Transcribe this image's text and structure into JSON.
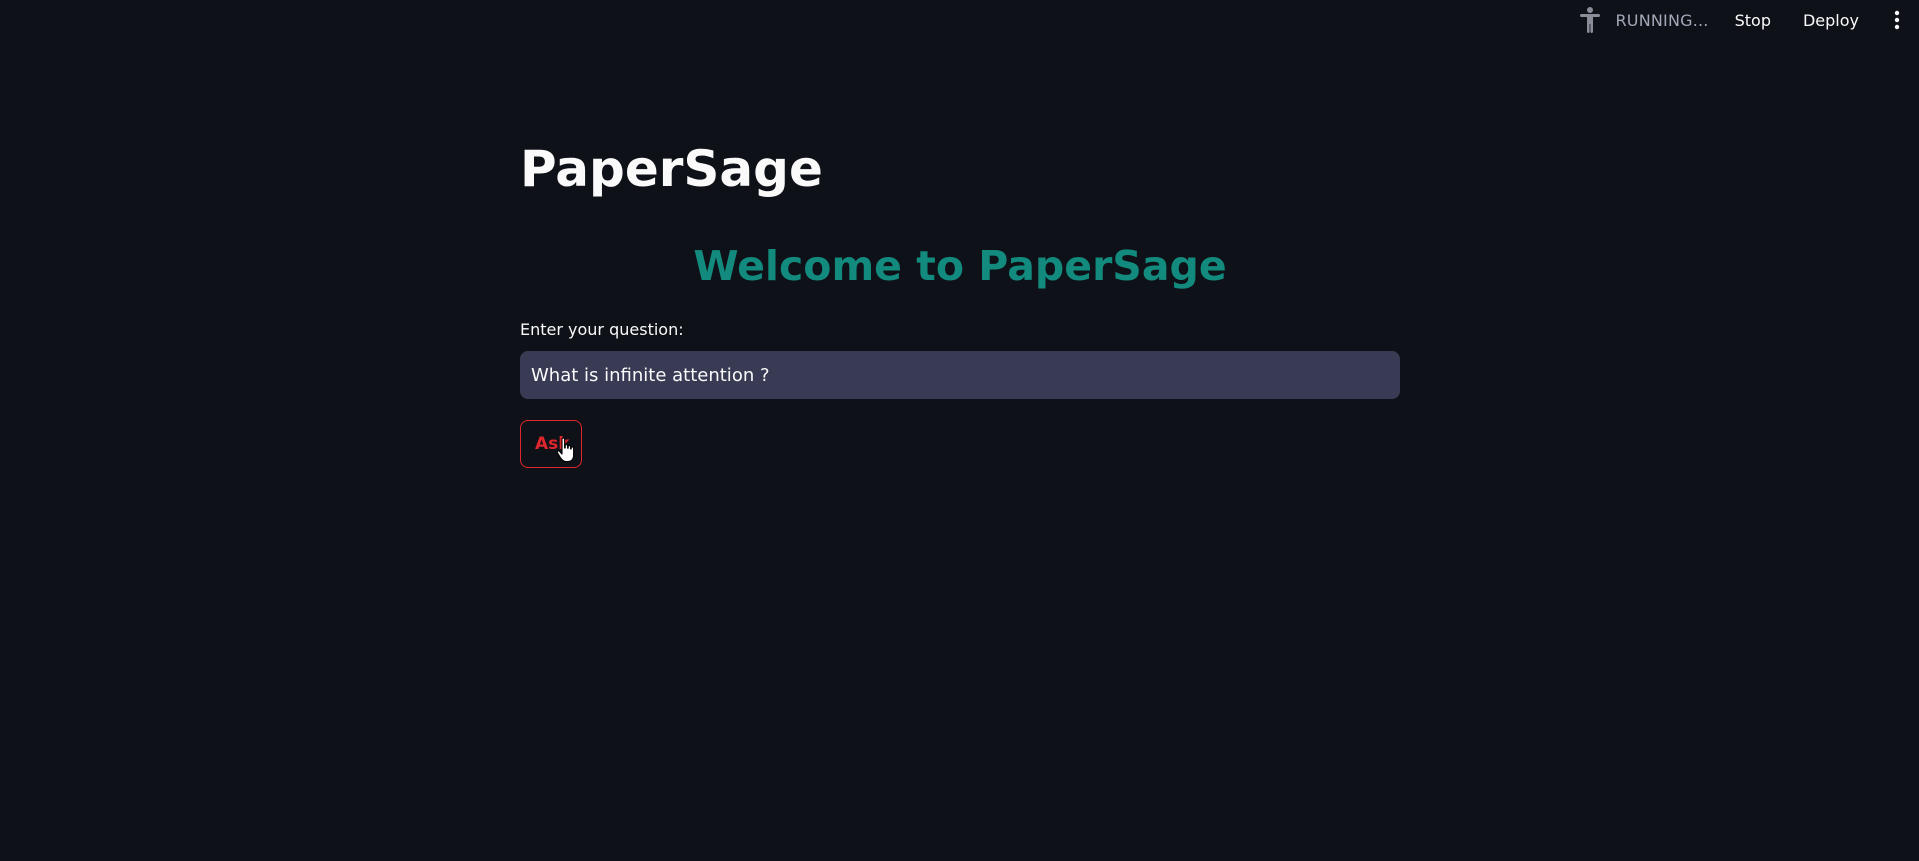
{
  "toolbar": {
    "status_icon": "accessibility-person-icon",
    "status_text": "RUNNING...",
    "stop_label": "Stop",
    "deploy_label": "Deploy",
    "menu_icon": "more-vertical-icon"
  },
  "main": {
    "app_title": "PaperSage",
    "welcome_heading": "Welcome to PaperSage",
    "question_label": "Enter your question:",
    "question_value": "What is infinite attention ?",
    "ask_label": "Ask"
  },
  "colors": {
    "background": "#0e1117",
    "heading_accent": "#138a7e",
    "input_background": "#393a54",
    "button_accent": "#e0262d",
    "text": "#fafafa",
    "muted_text": "#a3a8b8"
  },
  "cursor": {
    "icon": "hand-pointer-icon"
  }
}
